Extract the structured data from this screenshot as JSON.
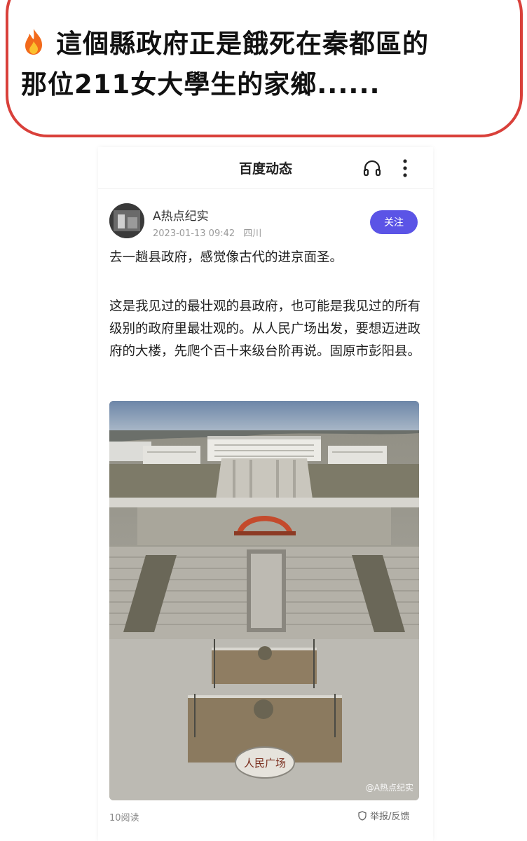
{
  "caption": {
    "line1": "這個縣政府正是餓死在秦都區的",
    "line2": "那位211女大學生的家鄉......"
  },
  "appbar": {
    "title": "百度动态",
    "icons": [
      "headphone-icon",
      "more-icon"
    ]
  },
  "post": {
    "author": "A热点纪实",
    "date": "2023-01-13 09:42",
    "location": "四川",
    "follow_label": "关注",
    "paragraph1": "去一趟县政府，感觉像古代的进京面圣。",
    "paragraph2": "这是我见过的最壮观的县政府，也可能是我见过的所有级别的政府里最壮观的。从人民广场出发，要想迈进政府的大楼，先爬个百十来级台阶再说。固原市彭阳县。",
    "watermark": "@A热点纪实",
    "stone_text": "人民广场",
    "reads": "10阅读",
    "report": "举报/反馈"
  },
  "colors": {
    "frame": "#d9403a",
    "follow_button": "#5b54e6"
  }
}
